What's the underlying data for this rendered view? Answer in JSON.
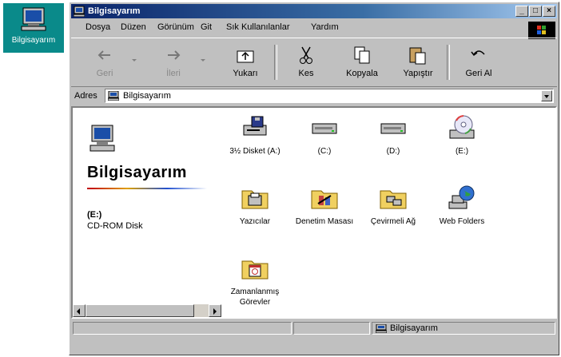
{
  "desktop": {
    "icon_label": "Bilgisayarım"
  },
  "window": {
    "title": "Bilgisayarım",
    "buttons": {
      "minimize": "_",
      "maximize": "□",
      "close": "×"
    }
  },
  "menu": [
    {
      "label": "Dosya"
    },
    {
      "label": "Düzen"
    },
    {
      "label": "Görünüm"
    },
    {
      "label": "Git"
    },
    {
      "label": "Sık Kullanılanlar"
    },
    {
      "label": "Yardım"
    }
  ],
  "toolbar": {
    "back": "Geri",
    "forward": "İleri",
    "up": "Yukarı",
    "cut": "Kes",
    "copy": "Kopyala",
    "paste": "Yapıştır",
    "undo": "Geri Al"
  },
  "address": {
    "label": "Adres",
    "value": "Bilgisayarım"
  },
  "left_panel": {
    "title": "Bilgisayarım",
    "drive": "(E:)",
    "description": "CD-ROM Disk"
  },
  "items": [
    {
      "label": "3½ Disket (A:)"
    },
    {
      "label": "(C:)"
    },
    {
      "label": "(D:)"
    },
    {
      "label": "(E:)"
    },
    {
      "label": "Yazıcılar"
    },
    {
      "label": "Denetim Masası"
    },
    {
      "label": "Çevirmeli Ağ"
    },
    {
      "label": "Web Folders"
    },
    {
      "label": "Zamanlanmış Görevler"
    }
  ],
  "status": {
    "text": "Bilgisayarım"
  }
}
